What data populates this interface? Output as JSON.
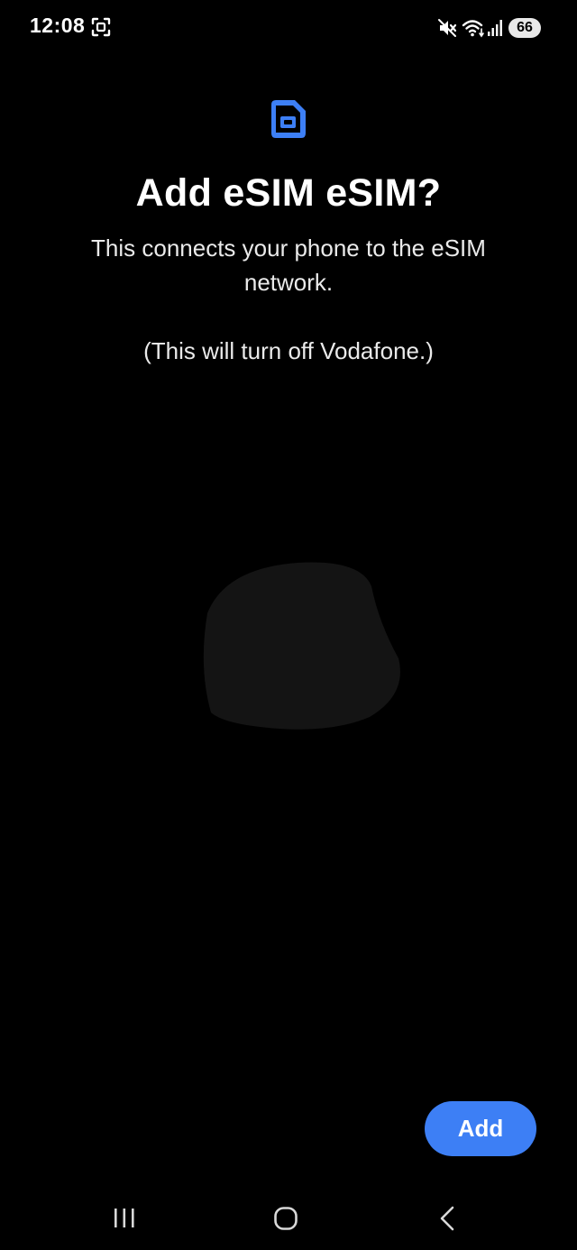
{
  "status_bar": {
    "time": "12:08",
    "battery": "66",
    "icons": [
      "screenshot-icon",
      "mute-vibrate-icon",
      "wifi-icon",
      "signal-icon"
    ]
  },
  "dialog": {
    "icon": "sim-card-icon",
    "title": "Add eSIM eSIM?",
    "description": "This connects your phone to the eSIM network.",
    "note": "(This will turn off Vodafone.)"
  },
  "actions": {
    "add_label": "Add"
  },
  "nav_bar": {
    "icons": [
      "recent-apps-icon",
      "home-icon",
      "back-icon"
    ]
  },
  "colors": {
    "background": "#000000",
    "accent": "#3d7ff5",
    "text": "#ffffff"
  }
}
